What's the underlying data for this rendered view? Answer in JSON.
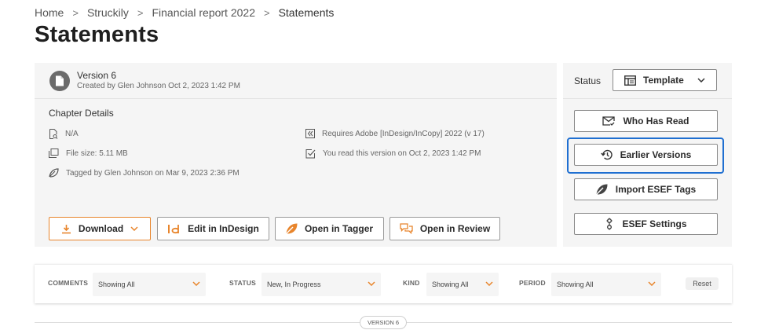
{
  "breadcrumb": {
    "items": [
      "Home",
      "Struckily",
      "Financial report 2022"
    ],
    "current": "Statements",
    "separator": ">"
  },
  "page_title": "Statements",
  "version": {
    "title": "Version 6",
    "created": "Created by Glen Johnson Oct 2, 2023 1:42 PM"
  },
  "chapter": {
    "title": "Chapter Details",
    "na": "N/A",
    "file_size": "File size: 5.11 MB",
    "tagged": "Tagged by Glen Johnson on Mar 9, 2023 2:36 PM",
    "requires": "Requires Adobe [InDesign/InCopy] 2022 (v 17)",
    "read": "You read this version on Oct 2, 2023 1:42 PM"
  },
  "actions": {
    "download": "Download",
    "edit_indesign": "Edit in InDesign",
    "open_tagger": "Open in Tagger",
    "open_review": "Open in Review"
  },
  "status": {
    "label": "Status",
    "value": "Template"
  },
  "side_actions": {
    "who_has_read": "Who Has Read",
    "earlier_versions": "Earlier Versions",
    "import_esef": "Import ESEF Tags",
    "esef_settings": "ESEF Settings"
  },
  "filters": {
    "comments": {
      "label": "COMMENTS",
      "value": "Showing All"
    },
    "status": {
      "label": "STATUS",
      "value": "New, In Progress"
    },
    "kind": {
      "label": "KIND",
      "value": "Showing All"
    },
    "period": {
      "label": "PERIOD",
      "value": "Showing All"
    },
    "reset": "Reset"
  },
  "divider_label": "VERSION 6",
  "colors": {
    "accent_orange": "#e8852c",
    "focus_blue": "#1f6fd1",
    "panel_bg": "#f5f5f5"
  }
}
